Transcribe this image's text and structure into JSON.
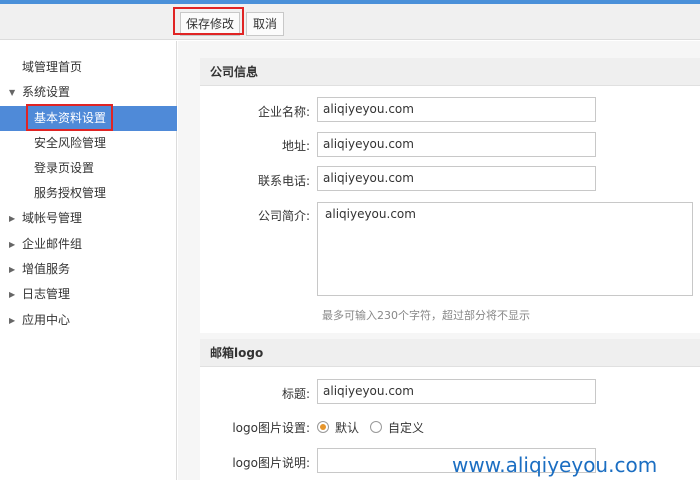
{
  "toolbar": {
    "save_label": "保存修改",
    "cancel_label": "取消"
  },
  "sidebar": {
    "items": [
      {
        "label": "域管理首页"
      },
      {
        "label": "系统设置",
        "arrow": "▼"
      },
      {
        "label": "基本资料设置"
      },
      {
        "label": "安全风险管理"
      },
      {
        "label": "登录页设置"
      },
      {
        "label": "服务授权管理"
      },
      {
        "label": "域帐号管理",
        "arrow": "▶"
      },
      {
        "label": "企业邮件组",
        "arrow": "▶"
      },
      {
        "label": "增值服务",
        "arrow": "▶"
      },
      {
        "label": "日志管理",
        "arrow": "▶"
      },
      {
        "label": "应用中心",
        "arrow": "▶"
      }
    ]
  },
  "company": {
    "title": "公司信息",
    "name_label": "企业名称:",
    "name_value": "aliqiyeyou.com",
    "address_label": "地址:",
    "address_value": "aliqiyeyou.com",
    "phone_label": "联系电话:",
    "phone_value": "aliqiyeyou.com",
    "intro_label": "公司简介:",
    "intro_value": "aliqiyeyou.com",
    "intro_hint": "最多可输入230个字符，超过部分将不显示"
  },
  "mail_logo": {
    "title": "邮箱logo",
    "title_label": "标题:",
    "title_value": "aliqiyeyou.com",
    "image_label": "logo图片设置:",
    "option_default": "默认",
    "option_custom": "自定义",
    "desc_label": "logo图片说明:",
    "desc_value": ""
  },
  "watermark": "www.aliqiyeyou.com",
  "colors": {
    "accent": "#4f8ad8",
    "highlight": "#e02424",
    "radio_checked": "#e6952b"
  }
}
